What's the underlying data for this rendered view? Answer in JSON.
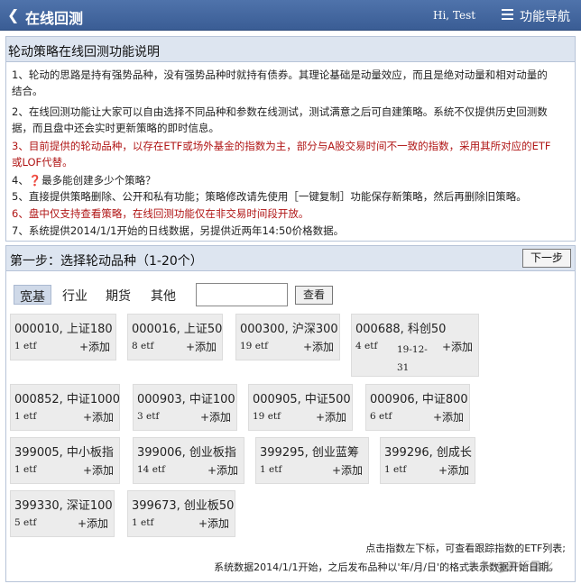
{
  "header": {
    "title": "在线回测",
    "user": "Hi, Test",
    "nav_label": "功能导航",
    "accent": "#3f63a0"
  },
  "notes_section": {
    "title": "轮动策略在线回测功能说明",
    "lines": [
      "1、轮动的思路是持有强势品种，没有强势品种时就持有债券。其理论基础是动量效应，而且是绝对动量和相对动量的",
      "结合。",
      "2、在线回测功能让大家可以自由选择不同品种和参数在线测试，测试满意之后可自建策略。系统不仅提供历史回测数",
      "据，而且盘中还会实时更新策略的即时信息。",
      "3、目前提供的轮动品种，以存在ETF或场外基金的指数为主，部分与A股交易时间不一致的指数，采用其所对应的ETF",
      "或LOF代替。",
      "4、❓最多能创建多少个策略？",
      "5、直接提供策略删除、公开和私有功能；策略修改请先使用［一键复制］功能保存新策略，然后再删除旧策略。",
      "6、盘中仅支持查看策略，在线回测功能仅在非交易时间段开放。",
      "7、系统提供2014/1/1开始的日线数据，另提供近两年14:50价格数据。"
    ]
  },
  "step_section": {
    "title": "第一步：选择轮动品种（1-20个）",
    "next_label": "下一步",
    "tabs": [
      "宽基",
      "行业",
      "期货",
      "其他"
    ],
    "search_value": "",
    "query_label": "查看",
    "cards": [
      {
        "name": "000010, 上证180",
        "etf": "1 etf",
        "date": "",
        "add": "+添加"
      },
      {
        "name": "000016, 上证50",
        "etf": "8 etf",
        "date": "",
        "add": "+添加"
      },
      {
        "name": "000300, 沪深300",
        "etf": "19 etf",
        "date": "",
        "add": "+添加"
      },
      {
        "name": "000688, 科创50",
        "etf": "4 etf",
        "date": "19-12-31",
        "add": "+添加"
      },
      {
        "name": "000852, 中证1000",
        "etf": "1 etf",
        "date": "",
        "add": "+添加"
      },
      {
        "name": "000903, 中证100",
        "etf": "3 etf",
        "date": "",
        "add": "+添加"
      },
      {
        "name": "000905, 中证500",
        "etf": "19 etf",
        "date": "",
        "add": "+添加"
      },
      {
        "name": "000906, 中证800",
        "etf": "6 etf",
        "date": "",
        "add": "+添加"
      },
      {
        "name": "399005, 中小板指",
        "etf": "1 etf",
        "date": "",
        "add": "+添加"
      },
      {
        "name": "399006, 创业板指",
        "etf": "14 etf",
        "date": "",
        "add": "+添加"
      },
      {
        "name": "399295, 创业蓝筹",
        "etf": "1 etf",
        "date": "",
        "add": "+添加"
      },
      {
        "name": "399296, 创成长",
        "etf": "1 etf",
        "date": "",
        "add": "+添加"
      },
      {
        "name": "399330, 深证100",
        "etf": "5 etf",
        "date": "",
        "add": "+添加"
      },
      {
        "name": "399673, 创业板50",
        "etf": "1 etf",
        "date": "",
        "add": "+添加"
      }
    ],
    "footnote_1": "点击指数左下标，可查看跟踪指数的ETF列表;",
    "footnote_2": "系统数据2014/1/1开始，之后发布品种以'年/月/日'的格式表示数据开始日期。"
  },
  "watermark": "头条 @云衍量化"
}
